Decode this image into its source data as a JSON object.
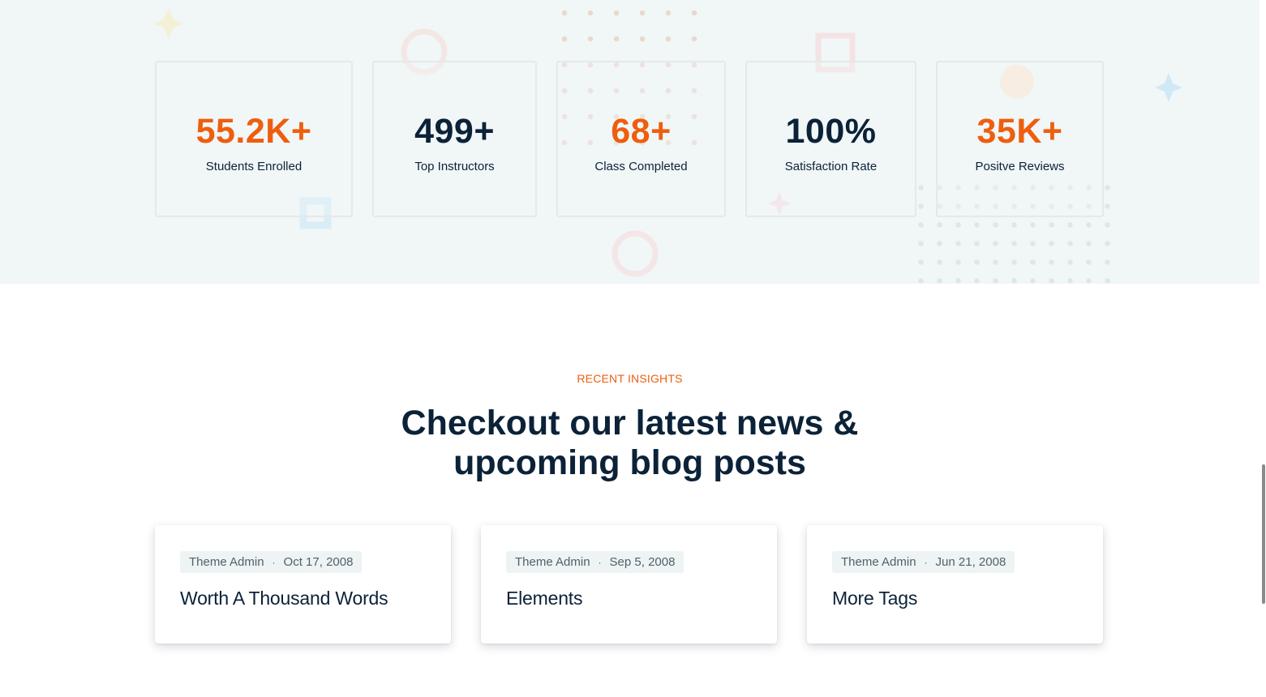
{
  "stats": [
    {
      "value": "55.2K",
      "suffix": "+",
      "label": "Students Enrolled",
      "color": "#ee5e0e"
    },
    {
      "value": "499",
      "suffix": "+",
      "label": "Top Instructors",
      "color": "#0b2238"
    },
    {
      "value": "68",
      "suffix": "+",
      "label": "Class Completed",
      "color": "#ee5e0e"
    },
    {
      "value": "100",
      "suffix": "%",
      "label": "Satisfaction Rate",
      "color": "#0b2238"
    },
    {
      "value": "35K",
      "suffix": "+",
      "label": "Positve Reviews",
      "color": "#ee5e0e"
    }
  ],
  "blog": {
    "eyebrow": "RECENT INSIGHTS",
    "heading_line1": "Checkout our latest news &",
    "heading_line2": "upcoming blog posts",
    "posts": [
      {
        "author": "Theme Admin",
        "date": "Oct 17, 2008",
        "title": "Worth A Thousand Words"
      },
      {
        "author": "Theme Admin",
        "date": "Sep 5, 2008",
        "title": "Elements"
      },
      {
        "author": "Theme Admin",
        "date": "Jun 21, 2008",
        "title": "More Tags"
      }
    ],
    "meta_separator": "·"
  },
  "colors": {
    "accent": "#ee5e0e",
    "navy": "#0b2238",
    "band_bg": "#f1f6f7"
  }
}
